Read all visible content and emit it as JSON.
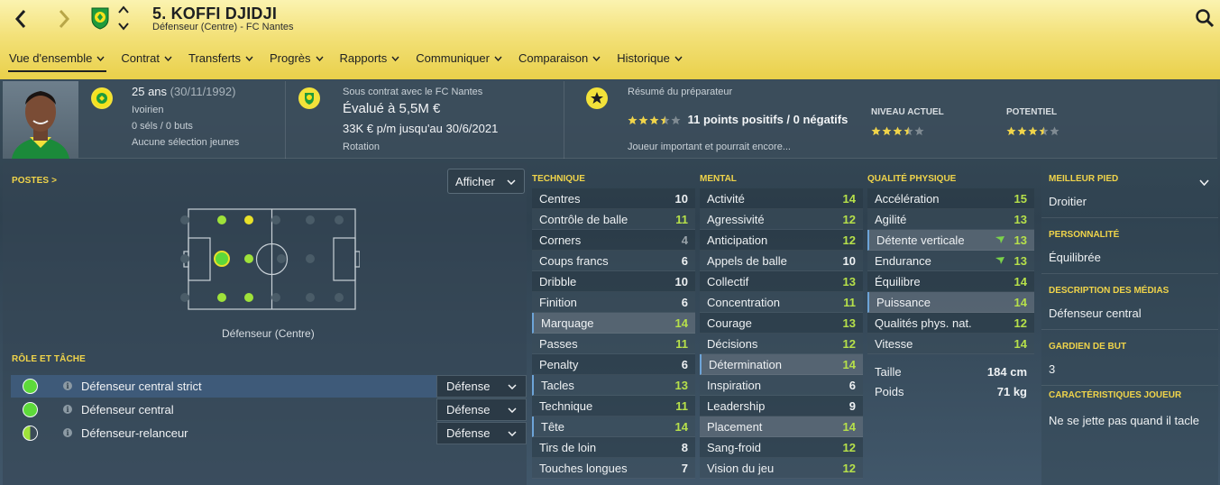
{
  "header": {
    "player_name": "5. KOFFI DJIDJI",
    "subtitle": "Défenseur (Centre) - FC Nantes",
    "icons": [
      "back-arrow-icon",
      "forward-arrow-icon",
      "club-badge-icon",
      "chevron-up-icon",
      "chevron-down-icon",
      "search-icon"
    ],
    "tabs": [
      {
        "label": "Vue d'ensemble",
        "active": true
      },
      {
        "label": "Contrat"
      },
      {
        "label": "Transferts"
      },
      {
        "label": "Progrès"
      },
      {
        "label": "Rapports"
      },
      {
        "label": "Communiquer"
      },
      {
        "label": "Comparaison"
      },
      {
        "label": "Historique"
      }
    ]
  },
  "overview": {
    "age": "25 ans",
    "birth_date": "(30/11/1992)",
    "nationality": "Ivoirien",
    "caps": "0 séls / 0 buts",
    "youth_caps": "Aucune sélection jeunes",
    "contract_label": "Sous contrat avec le FC Nantes",
    "value": "Évalué à 5,5M €",
    "wage": "33K € p/m jusqu'au 30/6/2021",
    "squad_status": "Rotation",
    "coach_title": "Résumé du préparateur",
    "coach_points": "11 points positifs / 0 négatifs",
    "coach_summary": "Joueur important et pourrait encore...",
    "coach_stars": 3.5,
    "current_ability_label": "NIVEAU ACTUEL",
    "current_ability_stars": 3.5,
    "potential_label": "POTENTIEL",
    "potential_stars": 3.5
  },
  "positions": {
    "title": "POSTES",
    "title_arrow": ">",
    "show_button": "Afficher",
    "caption": "Défenseur (Centre)"
  },
  "roles": {
    "title": "RÔLE ET TÂCHE",
    "items": [
      {
        "name": "Défenseur central strict",
        "duty": "Défense",
        "selected": true
      },
      {
        "name": "Défenseur central",
        "duty": "Défense"
      },
      {
        "name": "Défenseur-relanceur",
        "duty": "Défense"
      }
    ]
  },
  "attributes": {
    "technical": {
      "title": "TECHNIQUE",
      "rows": [
        {
          "label": "Centres",
          "value": "10"
        },
        {
          "label": "Contrôle de balle",
          "value": "11"
        },
        {
          "label": "Corners",
          "value": "4"
        },
        {
          "label": "Coups francs",
          "value": "6"
        },
        {
          "label": "Dribble",
          "value": "10"
        },
        {
          "label": "Finition",
          "value": "6"
        },
        {
          "label": "Marquage",
          "value": "14"
        },
        {
          "label": "Passes",
          "value": "11"
        },
        {
          "label": "Penalty",
          "value": "6"
        },
        {
          "label": "Tacles",
          "value": "13"
        },
        {
          "label": "Technique",
          "value": "11"
        },
        {
          "label": "Tête",
          "value": "14"
        },
        {
          "label": "Tirs de loin",
          "value": "8"
        },
        {
          "label": "Touches longues",
          "value": "7"
        }
      ]
    },
    "mental": {
      "title": "MENTAL",
      "rows": [
        {
          "label": "Activité",
          "value": "14"
        },
        {
          "label": "Agressivité",
          "value": "12"
        },
        {
          "label": "Anticipation",
          "value": "12"
        },
        {
          "label": "Appels de balle",
          "value": "10"
        },
        {
          "label": "Collectif",
          "value": "13"
        },
        {
          "label": "Concentration",
          "value": "11"
        },
        {
          "label": "Courage",
          "value": "13"
        },
        {
          "label": "Décisions",
          "value": "12"
        },
        {
          "label": "Détermination",
          "value": "14"
        },
        {
          "label": "Inspiration",
          "value": "6"
        },
        {
          "label": "Leadership",
          "value": "9"
        },
        {
          "label": "Placement",
          "value": "14"
        },
        {
          "label": "Sang-froid",
          "value": "12"
        },
        {
          "label": "Vision du jeu",
          "value": "12"
        }
      ]
    },
    "physical": {
      "title": "QUALITÉ PHYSIQUE",
      "rows": [
        {
          "label": "Accélération",
          "value": "15"
        },
        {
          "label": "Agilité",
          "value": "13"
        },
        {
          "label": "Détente verticale",
          "value": "13"
        },
        {
          "label": "Endurance",
          "value": "13"
        },
        {
          "label": "Équilibre",
          "value": "14"
        },
        {
          "label": "Puissance",
          "value": "14"
        },
        {
          "label": "Qualités phys. nat.",
          "value": "12"
        },
        {
          "label": "Vitesse",
          "value": "14"
        }
      ],
      "height_label": "Taille",
      "height_value": "184 cm",
      "weight_label": "Poids",
      "weight_value": "71 kg"
    }
  },
  "info": {
    "preferred_foot_title": "MEILLEUR PIED",
    "preferred_foot": "Droitier",
    "personality_title": "PERSONNALITÉ",
    "personality": "Équilibrée",
    "media_title": "DESCRIPTION DES MÉDIAS",
    "media": "Défenseur central",
    "goalkeeper_title": "GARDIEN DE BUT",
    "goalkeeper": "3",
    "traits_title": "CARACTÉRISTIQUES JOUEUR",
    "traits": "Ne se jette pas quand il tacle"
  },
  "colors": {
    "header_yellow": "#f3e179",
    "accent_yellow": "#f0d44a",
    "value_green": "#b6e04a",
    "value_grey": "#9aa3aa",
    "position_green": "#5dd93a",
    "position_yellow": "#e8e12a"
  }
}
